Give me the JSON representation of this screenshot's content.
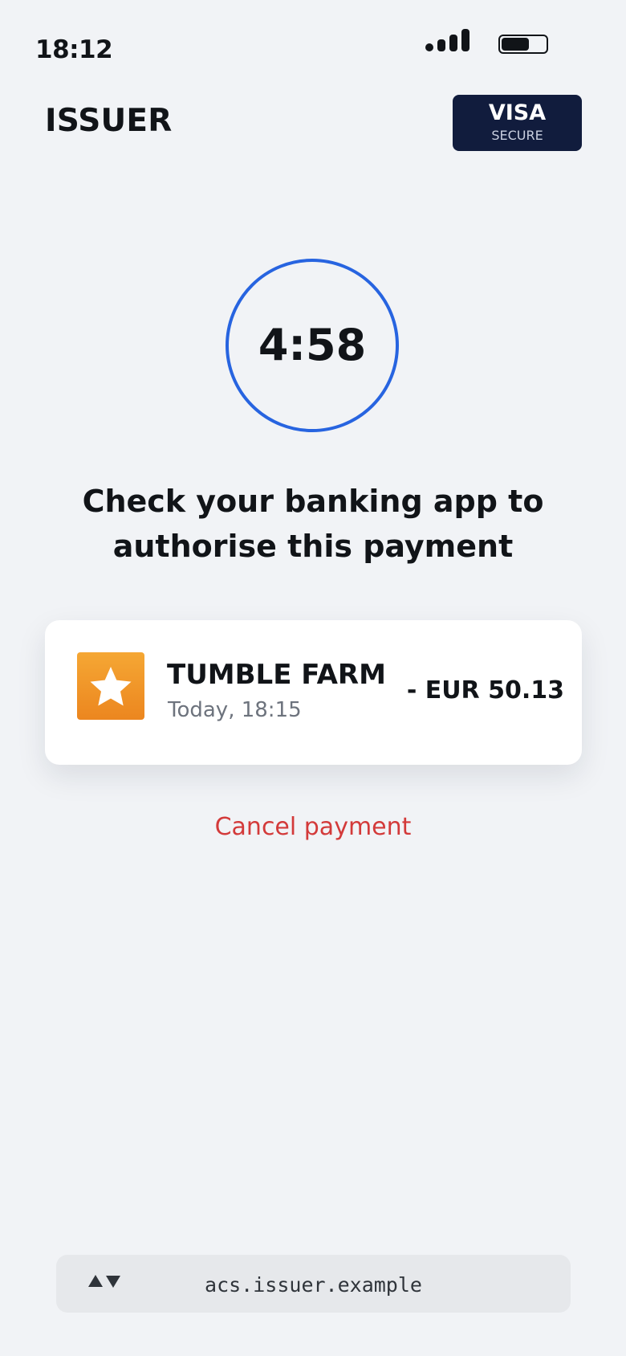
{
  "status_bar": {
    "time": "18:12",
    "signal_icon": "signal-icon",
    "battery_icon": "battery-icon"
  },
  "header": {
    "issuer_name": "ISSUER",
    "badge": {
      "brand": "VISA",
      "subtitle": "SECURE",
      "background_color": "#111c3d"
    }
  },
  "timer": {
    "remaining": "4:58",
    "ring_color": "#2764e0"
  },
  "instruction": {
    "line1": "Check your banking app to",
    "line2": "authorise this payment"
  },
  "transaction": {
    "merchant_icon": "star-icon",
    "merchant_name": "TUMBLE FARM",
    "date": "Today, 18:15",
    "amount": "- EUR 50.13",
    "logo_color": "#f0931f"
  },
  "actions": {
    "cancel_label": "Cancel payment",
    "cancel_color": "#d33a3a"
  },
  "address_bar": {
    "arrows_icon": "page-navigation-arrows-icon",
    "url": "acs.issuer.example"
  }
}
